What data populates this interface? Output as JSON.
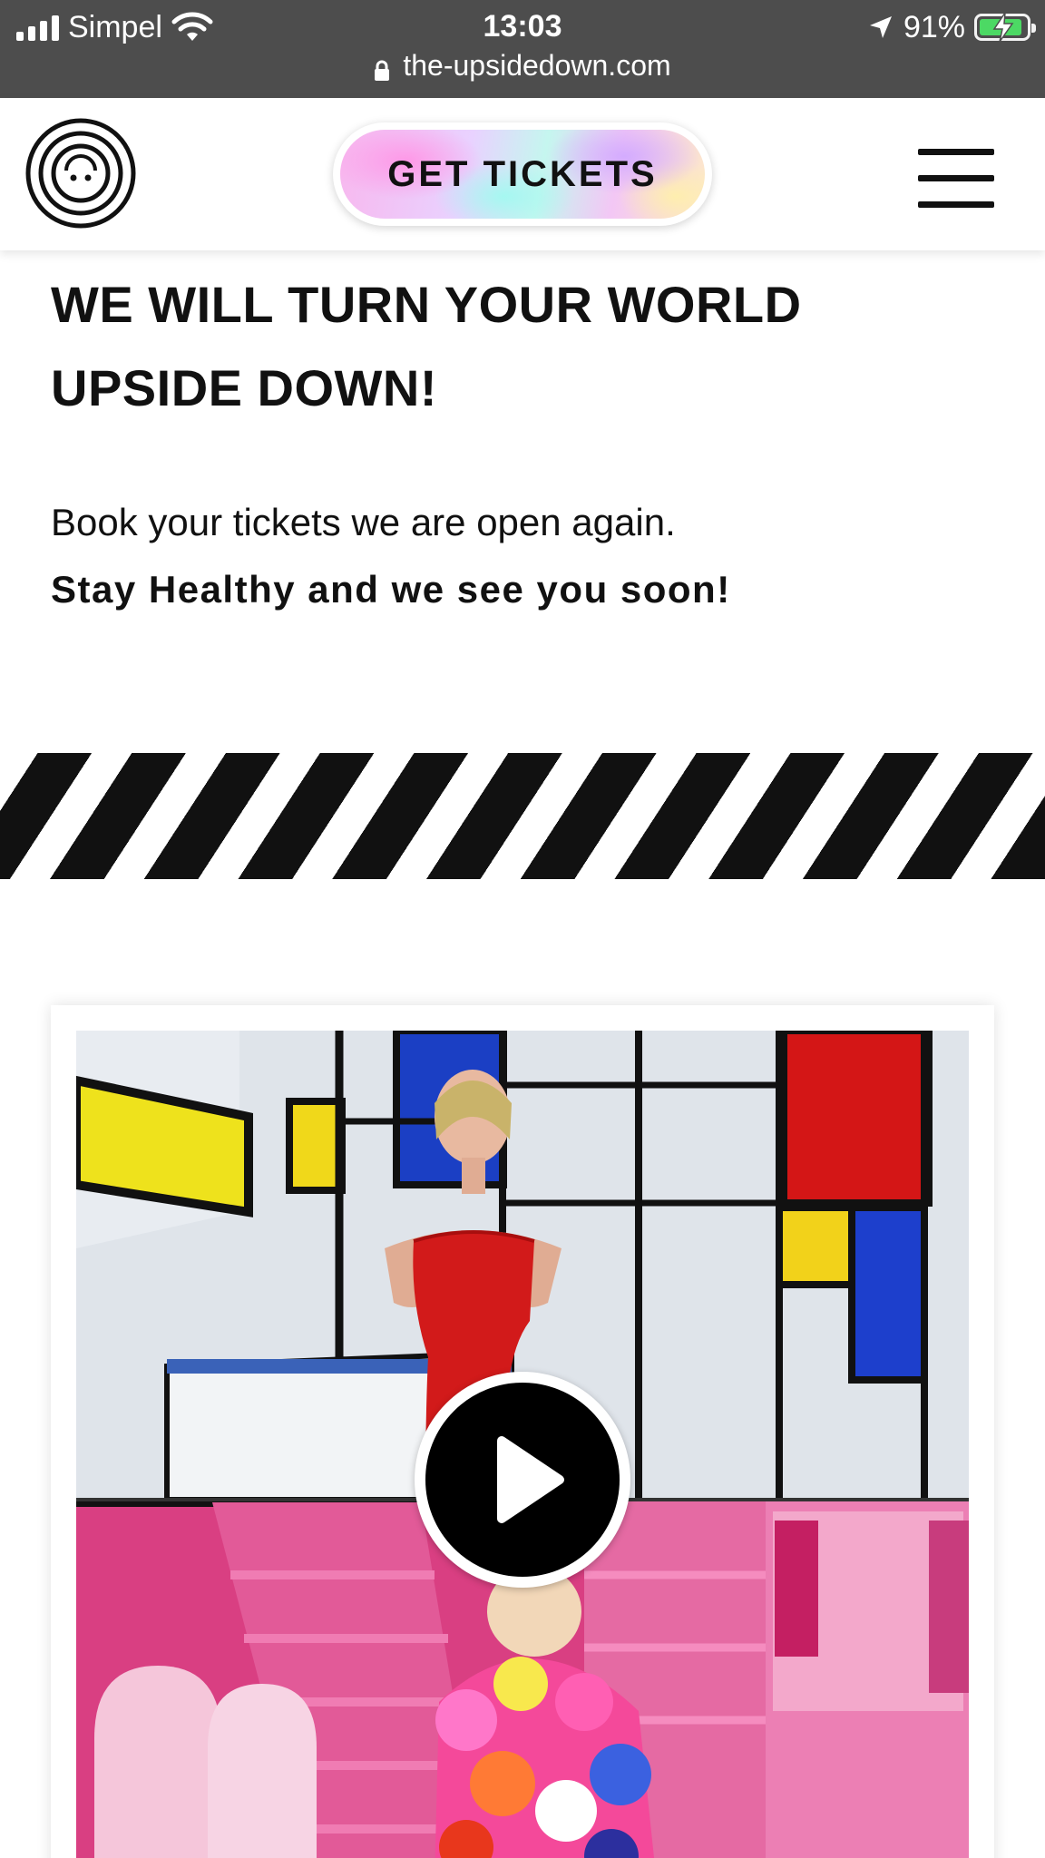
{
  "status_bar": {
    "carrier": "Simpel",
    "time": "13:03",
    "battery_percent": "91%",
    "battery_level": 0.91,
    "url": "the-upsidedown.com"
  },
  "header": {
    "logo_icon": "upside-down-smiley-logo-icon",
    "cta_label": "GET TICKETS",
    "menu_icon": "hamburger-menu-icon"
  },
  "hero": {
    "headline": "WE WILL TURN YOUR WORLD UPSIDE DOWN!",
    "lead": "Book your tickets we are open again.",
    "lead_bold": "Stay Healthy and we see you soon!"
  },
  "video": {
    "play_icon": "play-icon"
  },
  "colors": {
    "status_bar_bg": "#4d4d4d",
    "battery_green": "#4cd964",
    "stripe_dark": "#111111",
    "play_button_bg": "#000000"
  }
}
